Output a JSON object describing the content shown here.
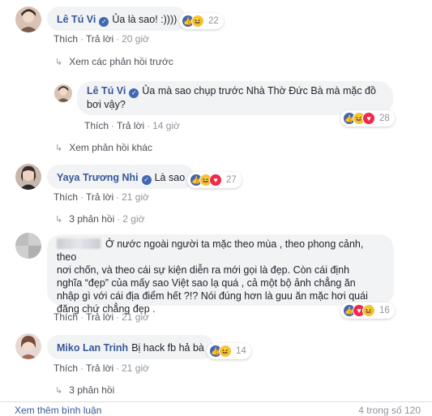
{
  "comments": [
    {
      "name": "Lê Tú Vi",
      "text": "Ủa là sao! :))))",
      "actions": {
        "like": "Thích",
        "reply": "Trả lời",
        "time": "20 giờ"
      },
      "reaction_count": "22",
      "reactions": [
        "like-icon",
        "haha-icon"
      ]
    },
    {
      "name": "Yaya Trương Nhi",
      "text": "Là sao",
      "actions": {
        "like": "Thích",
        "reply": "Trả lời",
        "time": "21 giờ"
      },
      "reaction_count": "27",
      "reactions": [
        "like-icon",
        "haha-icon",
        "love-icon"
      ],
      "replies_link": "3 phản hồi",
      "replies_time": "2 giờ"
    },
    {
      "name": "",
      "line1": "Ở nước ngoài người ta mặc theo mùa , theo phong cảnh, theo",
      "line2": "nơi chốn, và theo cái sự kiện diễn ra mới gọi là đẹp. Còn cái định",
      "line3": "nghĩa “đẹp” của mấy sao Việt sao lạ quá , cả một bộ ảnh chẳng ăn",
      "line4": "nhập gì với cái địa điểm hết ?!? Nói đúng hơn là guu ăn mặc hơi quái",
      "line5": "đăng chứ chẳng đẹp .",
      "actions": {
        "like": "Thích",
        "reply": "Trả lời",
        "time": "21 giờ"
      },
      "reaction_count": "16",
      "reactions": [
        "like-icon",
        "love-icon",
        "haha-icon"
      ]
    },
    {
      "name": "Miko Lan Trinh",
      "text": "Bị hack fb hả bà",
      "actions": {
        "like": "Thích",
        "reply": "Trả lời",
        "time": "21 giờ"
      },
      "reaction_count": "14",
      "reactions": [
        "like-icon",
        "haha-icon"
      ],
      "replies_link": "3 phản hồi"
    }
  ],
  "reply": {
    "name": "Lê Tú Vi",
    "line1": "Ủa mà sao chụp trước Nhà Thờ Đức Bà mà mặc đồ",
    "line2": "bơi vậy?",
    "actions": {
      "like": "Thích",
      "reply": "Trả lời",
      "time": "14 giờ"
    },
    "reaction_count": "28",
    "reactions": [
      "like-icon",
      "haha-icon",
      "love-icon"
    ]
  },
  "prev_replies": "Xem các phản hồi trước",
  "other_replies": "Xem phản hồi khác",
  "footer": {
    "more_comments": "Xem thêm bình luận",
    "count": "4 trong số 120"
  },
  "colors": {
    "link": "#385898",
    "bubble": "#f2f3f5",
    "meta": "#90949c",
    "like": "#4267b2",
    "love": "#f0284a",
    "haha": "#f7c33b"
  }
}
